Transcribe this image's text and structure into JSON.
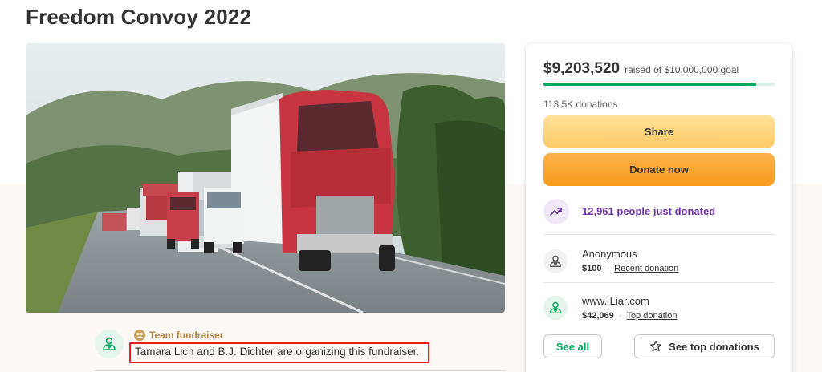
{
  "page": {
    "title": "Freedom Convoy 2022"
  },
  "hero": {
    "image_icon": "trucks-on-highway-photo"
  },
  "organizer": {
    "avatar_icon": "person-heart-icon",
    "badge_icon": "team-icon",
    "team_label": "Team fundraiser",
    "text": "Tamara Lich and B.J. Dichter are organizing this fundraiser."
  },
  "card": {
    "amount": "$9,203,520",
    "goal_text": "raised of $10,000,000 goal",
    "progress_fraction": 0.92,
    "donations_count": "113.5K donations",
    "share_label": "Share",
    "donate_label": "Donate now",
    "trend_icon": "trending-up-icon",
    "trend_text": "12,961 people just donated",
    "donations": [
      {
        "name": "Anonymous",
        "amount": "$100",
        "tag": "Recent donation",
        "icon": "person-heart-icon"
      },
      {
        "name": "www. Liar.com",
        "amount": "$42,069",
        "tag": "Top donation",
        "icon": "person-heart-icon"
      }
    ],
    "see_all_label": "See all",
    "see_top_label": "See top donations",
    "star_icon": "star-outline-icon"
  },
  "colors": {
    "accent_green": "#02a95c",
    "donate_orange": "#f89b1c",
    "share_yellow": "#fdca66",
    "trend_purple": "#6b35a2",
    "highlight_red": "#e02020"
  }
}
